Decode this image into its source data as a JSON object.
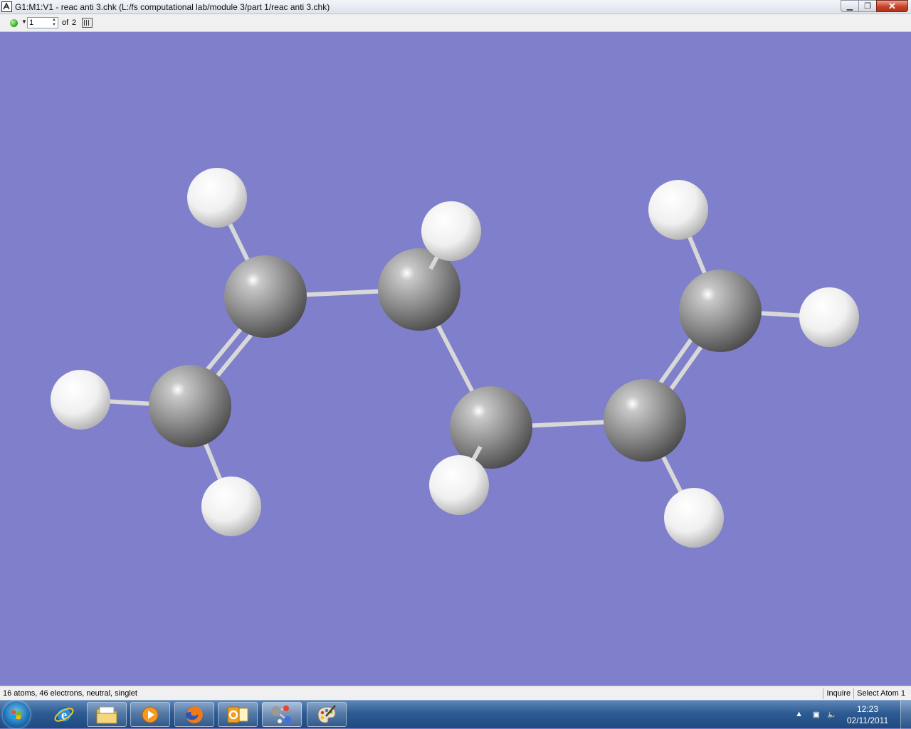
{
  "window": {
    "title": "G1:M1:V1 - reac anti 3.chk (L:/fs computational lab/module 3/part 1/reac anti 3.chk)"
  },
  "toolbar": {
    "frame_value": "1",
    "of_label": "of",
    "frame_total": "2"
  },
  "viewport": {
    "background_color": "#7f7fcc",
    "atom_colors": {
      "carbon": "#8c8c8c",
      "hydrogen": "#f2f2f2"
    },
    "bond_color": "#d8d8d8"
  },
  "status": {
    "summary": "16 atoms, 46 electrons, neutral, singlet",
    "mode": "Inquire",
    "selection": "Select Atom 1"
  },
  "taskbar": {
    "apps": [
      "internet-explorer",
      "windows-explorer",
      "media-player",
      "firefox",
      "outlook",
      "gaussview",
      "paint"
    ],
    "tray": {
      "time": "12:23",
      "date": "02/11/2011"
    }
  }
}
